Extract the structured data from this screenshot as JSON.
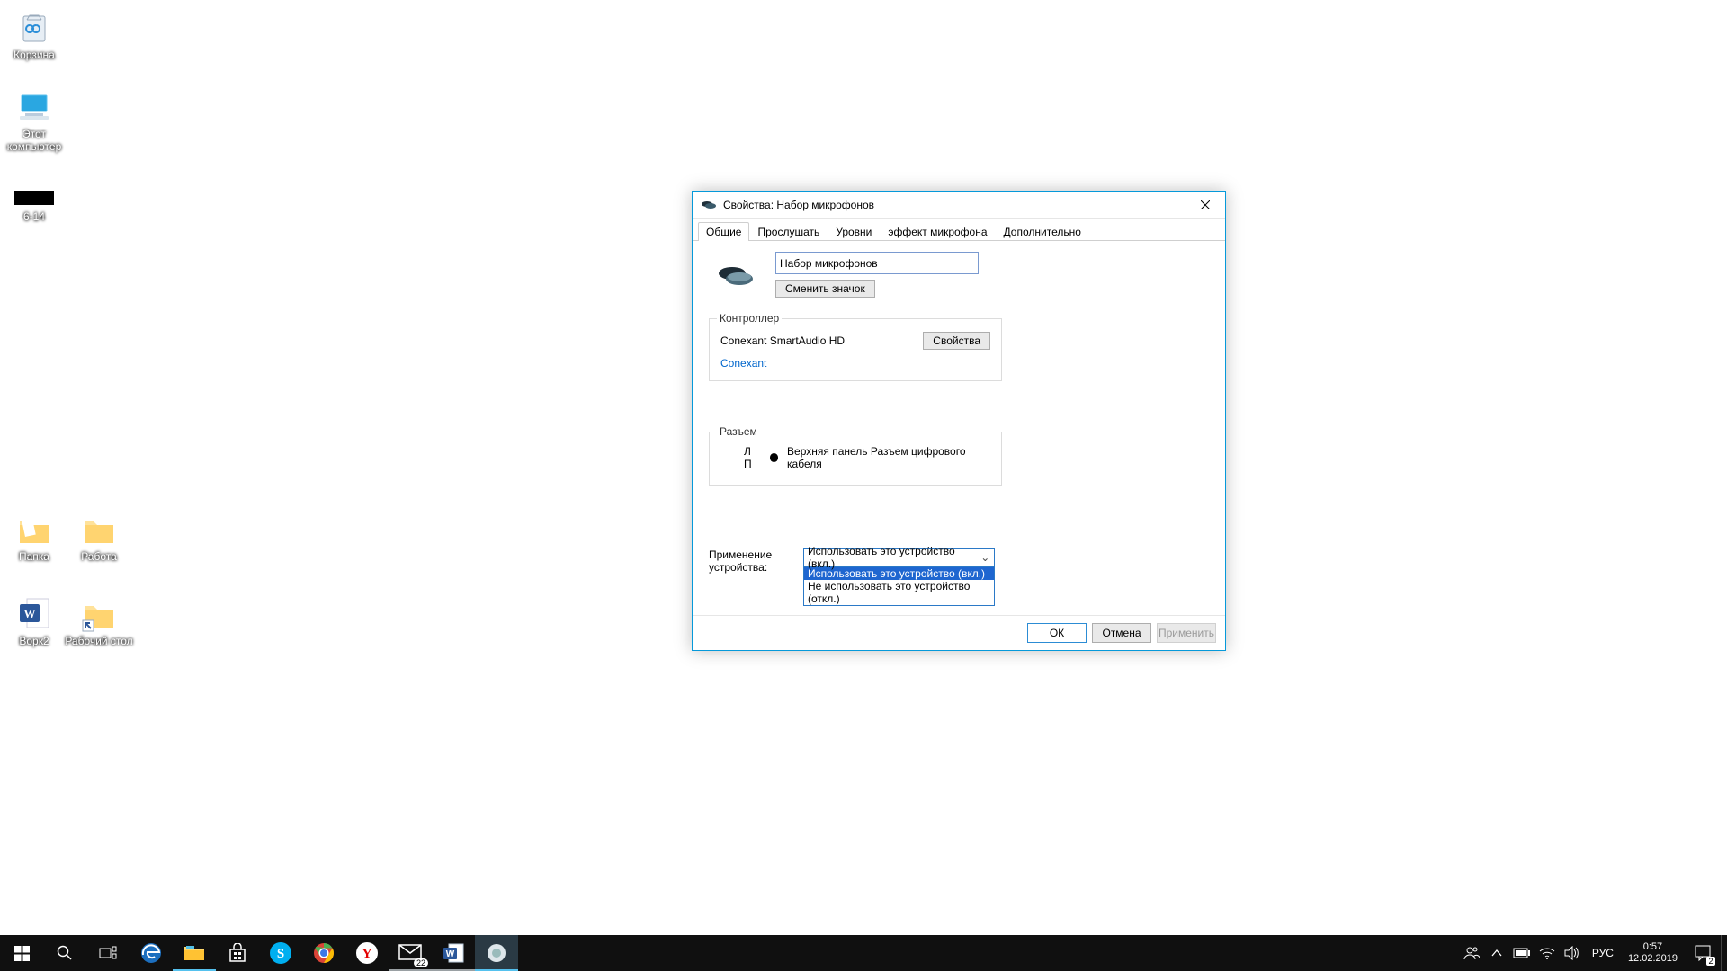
{
  "desktop": {
    "icons": [
      {
        "label": "Корзина"
      },
      {
        "label": "Этот компьютер"
      },
      {
        "label": "6-14"
      },
      {
        "label": "Папка"
      },
      {
        "label": "Работа"
      },
      {
        "label": "Ворк2"
      },
      {
        "label": "Рабочий стол"
      }
    ]
  },
  "dialog": {
    "title": "Свойства: Набор микрофонов",
    "tabs": [
      "Общие",
      "Прослушать",
      "Уровни",
      "эффект микрофона",
      "Дополнительно"
    ],
    "device_name": "Набор микрофонов",
    "change_icon": "Сменить значок",
    "controller": {
      "legend": "Контроллер",
      "name": "Conexant SmartAudio HD",
      "vendor": "Conexant",
      "properties": "Свойства"
    },
    "jack": {
      "legend": "Разъем",
      "lp": "Л П",
      "desc": "Верхняя панель Разъем цифрового кабеля"
    },
    "usage": {
      "label": "Применение устройства:",
      "selected": "Использовать это устройство (вкл.)",
      "options": [
        "Использовать это устройство (вкл.)",
        "Не использовать это устройство (откл.)"
      ]
    },
    "buttons": {
      "ok": "ОК",
      "cancel": "Отмена",
      "apply": "Применить"
    }
  },
  "taskbar": {
    "mail_badge": "22",
    "notif_badge": "2",
    "lang": "РУС",
    "time": "0:57",
    "date": "12.02.2019"
  }
}
